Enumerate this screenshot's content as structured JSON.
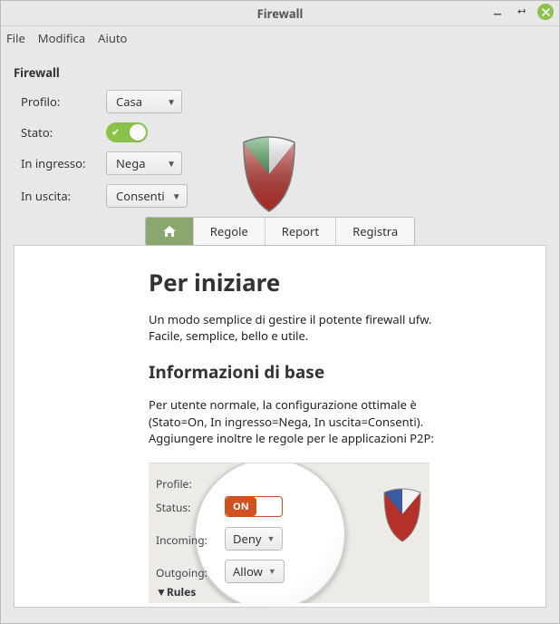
{
  "window": {
    "title": "Firewall"
  },
  "menu": {
    "file": "File",
    "edit": "Modifica",
    "help": "Aiuto"
  },
  "heading": "Firewall",
  "form": {
    "profile_label": "Profilo:",
    "profile_value": "Casa",
    "state_label": "Stato:",
    "state_on": true,
    "incoming_label": "In ingresso:",
    "incoming_value": "Nega",
    "outgoing_label": "In uscita:",
    "outgoing_value": "Consenti"
  },
  "tabs": {
    "home": "",
    "rules": "Regole",
    "report": "Report",
    "log": "Registra"
  },
  "doc": {
    "h1": "Per iniziare",
    "p1": "Un modo semplice di gestire il potente firewall ufw. Facile, semplice, bello e utile.",
    "h2": "Informazioni di base",
    "p2": "Per utente normale, la configurazione ottimale è (Stato=On, In ingresso=Nega, In uscita=Consenti). Aggiungere inoltre le regole per le applicazioni P2P:",
    "example": {
      "profile": "Profile:",
      "status": "Status:",
      "status_value": "ON",
      "incoming": "Incoming:",
      "incoming_value": "Deny",
      "outgoing": "Outgoing:",
      "outgoing_value": "Allow",
      "rules": "▼Rules"
    }
  }
}
